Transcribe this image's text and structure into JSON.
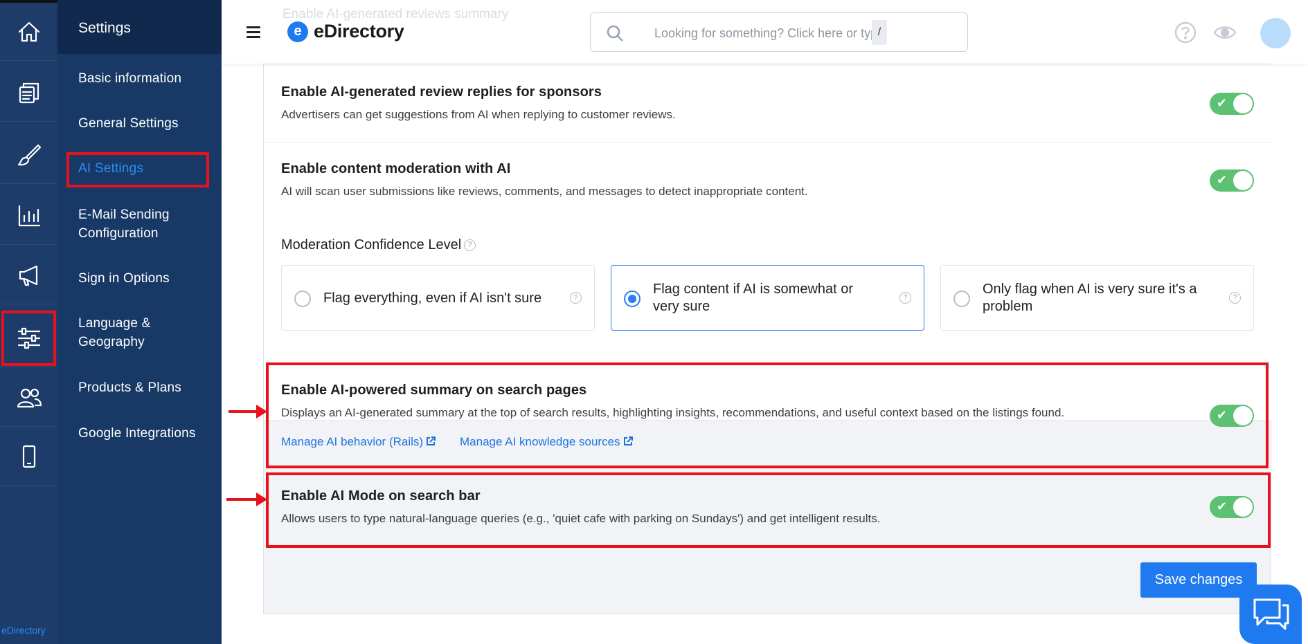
{
  "rail": {
    "brand": "eDirectory",
    "icons": [
      "home-icon",
      "pages-icon",
      "brush-icon",
      "chart-icon",
      "megaphone-icon",
      "sliders-icon",
      "users-icon",
      "mobile-icon"
    ]
  },
  "menu": {
    "title": "Settings",
    "items": [
      {
        "label": "Basic information"
      },
      {
        "label": "General Settings"
      },
      {
        "label": "AI Settings"
      },
      {
        "label": "E-Mail Sending Configuration"
      },
      {
        "label": "Sign in Options"
      },
      {
        "label": "Language & Geography"
      },
      {
        "label": "Products & Plans"
      },
      {
        "label": "Google Integrations"
      }
    ]
  },
  "header": {
    "brand_letter": "e",
    "brand_name": "eDirectory",
    "ghost_text": "Enable AI-generated reviews summary",
    "search_placeholder": "Looking for something? Click here or type",
    "search_shortcut": "/"
  },
  "settings": {
    "review_replies": {
      "title": "Enable AI-generated review replies for sponsors",
      "desc": "Advertisers can get suggestions from AI when replying to customer reviews.",
      "enabled": true
    },
    "moderation": {
      "title": "Enable content moderation with AI",
      "desc": "AI will scan user submissions like reviews, comments, and messages to detect inappropriate content.",
      "enabled": true
    },
    "confidence": {
      "label": "Moderation Confidence Level",
      "help": "?",
      "options": [
        {
          "label": "Flag everything, even if AI isn't sure",
          "selected": false
        },
        {
          "label": "Flag content if AI is somewhat or very sure",
          "selected": true
        },
        {
          "label": "Only flag when AI is very sure it's a problem",
          "selected": false
        }
      ]
    },
    "search_summary": {
      "title": "Enable AI-powered summary on search pages",
      "desc": "Displays an AI-generated summary at the top of search results, highlighting insights, recommendations, and useful context based on the listings found.",
      "link_behavior": "Manage AI behavior (Rails)",
      "link_sources": "Manage AI knowledge sources",
      "enabled": true
    },
    "ai_mode": {
      "title": "Enable AI Mode on search bar",
      "desc": "Allows users to type natural-language queries (e.g., 'quiet cafe with parking on Sundays') and get intelligent results.",
      "enabled": true
    }
  },
  "toggle_check": "✔",
  "save_label": "Save changes",
  "colors": {
    "accent": "#1f7af0",
    "toggle_on": "#5cc173",
    "highlight": "#e8121e",
    "sidebar": "#183966"
  }
}
